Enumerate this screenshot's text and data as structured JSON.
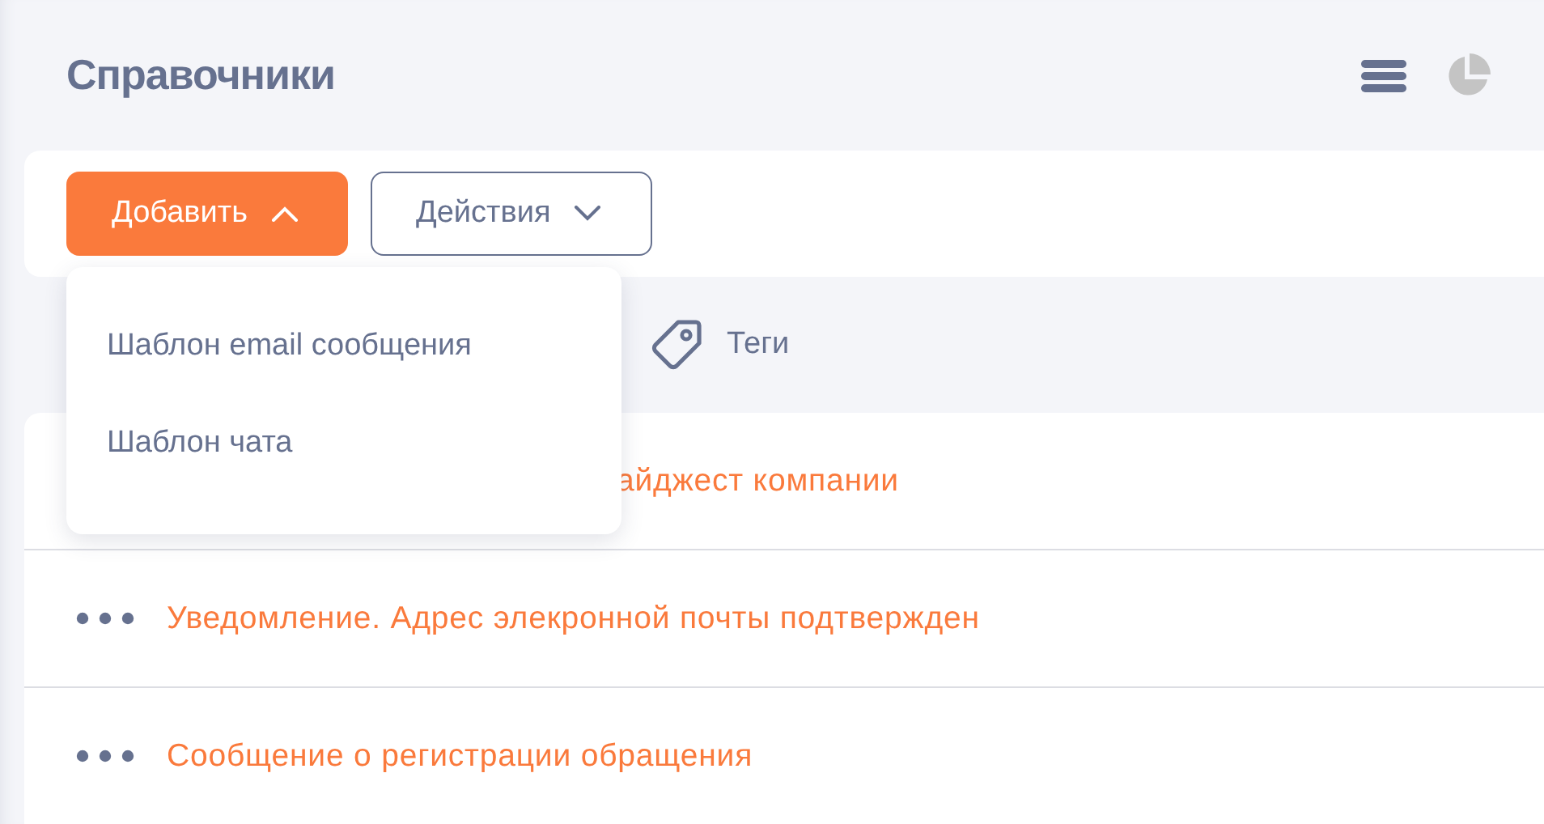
{
  "title": "Справочники",
  "toolbar": {
    "add_button": {
      "label": "Добавить",
      "expanded": true
    },
    "actions_button": {
      "label": "Действия"
    }
  },
  "add_menu": [
    "Шаблон email сообщения",
    "Шаблон чата"
  ],
  "tabs": [
    {
      "label": "Теги"
    }
  ],
  "rows": [
    {
      "kind": "partial",
      "text": "айджест компании"
    },
    {
      "kind": "full",
      "text": "Уведомление. Адрес элекронной почты подтвержден"
    },
    {
      "kind": "full",
      "text": "Сообщение о регистрации обращения"
    }
  ]
}
